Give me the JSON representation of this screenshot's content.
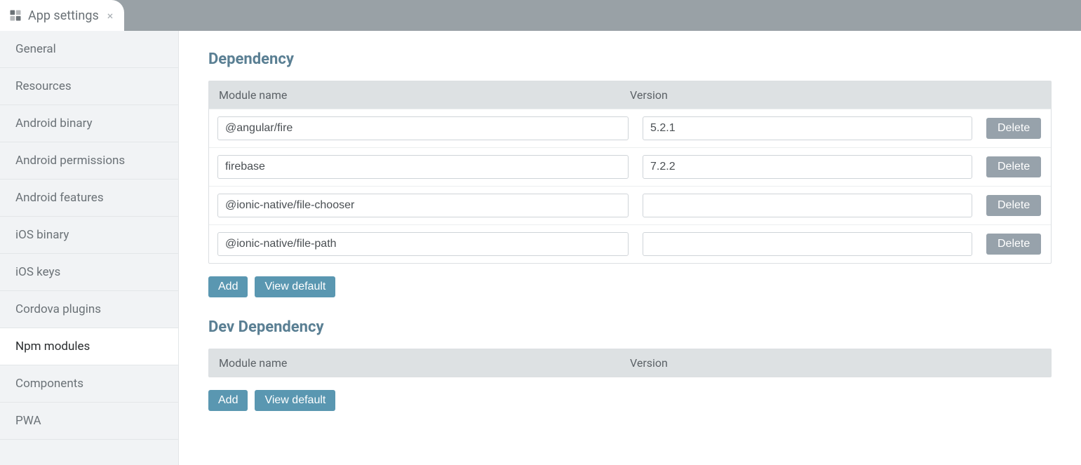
{
  "tab": {
    "title": "App settings",
    "close": "×"
  },
  "sidebar": {
    "items": [
      {
        "label": "General"
      },
      {
        "label": "Resources"
      },
      {
        "label": "Android binary"
      },
      {
        "label": "Android permissions"
      },
      {
        "label": "Android features"
      },
      {
        "label": "iOS binary"
      },
      {
        "label": "iOS keys"
      },
      {
        "label": "Cordova plugins"
      },
      {
        "label": "Npm modules"
      },
      {
        "label": "Components"
      },
      {
        "label": "PWA"
      }
    ],
    "active_index": 8
  },
  "sections": {
    "dependency": {
      "title": "Dependency",
      "columns": {
        "name": "Module name",
        "version": "Version"
      },
      "rows": [
        {
          "name": "@angular/fire",
          "version": "5.2.1"
        },
        {
          "name": "firebase",
          "version": "7.2.2"
        },
        {
          "name": "@ionic-native/file-chooser",
          "version": ""
        },
        {
          "name": "@ionic-native/file-path",
          "version": ""
        }
      ],
      "buttons": {
        "add": "Add",
        "view_default": "View default",
        "delete": "Delete"
      }
    },
    "dev_dependency": {
      "title": "Dev Dependency",
      "columns": {
        "name": "Module name",
        "version": "Version"
      },
      "rows": [],
      "buttons": {
        "add": "Add",
        "view_default": "View default"
      }
    }
  }
}
